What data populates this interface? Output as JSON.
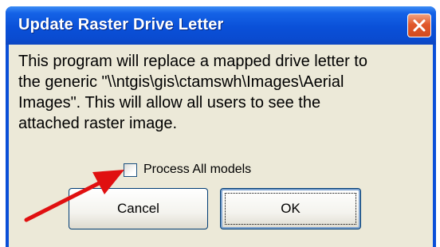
{
  "dialog": {
    "title": "Update Raster Drive Letter",
    "message_lines": [
      "This program will replace a mapped drive letter to",
      "the generic \"\\\\ntgis\\gis\\ctamswh\\Images\\Aerial",
      "Images\".  This will allow all users to see the",
      "attached raster image."
    ],
    "checkbox": {
      "label": "Process All models",
      "checked": false
    },
    "buttons": {
      "cancel": "Cancel",
      "ok": "OK"
    }
  },
  "colors": {
    "titlebar": "#0a4fd8",
    "client_background": "#ece9d8",
    "close_button": "#e1592c",
    "annotation_arrow": "#e01010"
  },
  "icons": [
    "close-icon",
    "annotation-arrow"
  ]
}
